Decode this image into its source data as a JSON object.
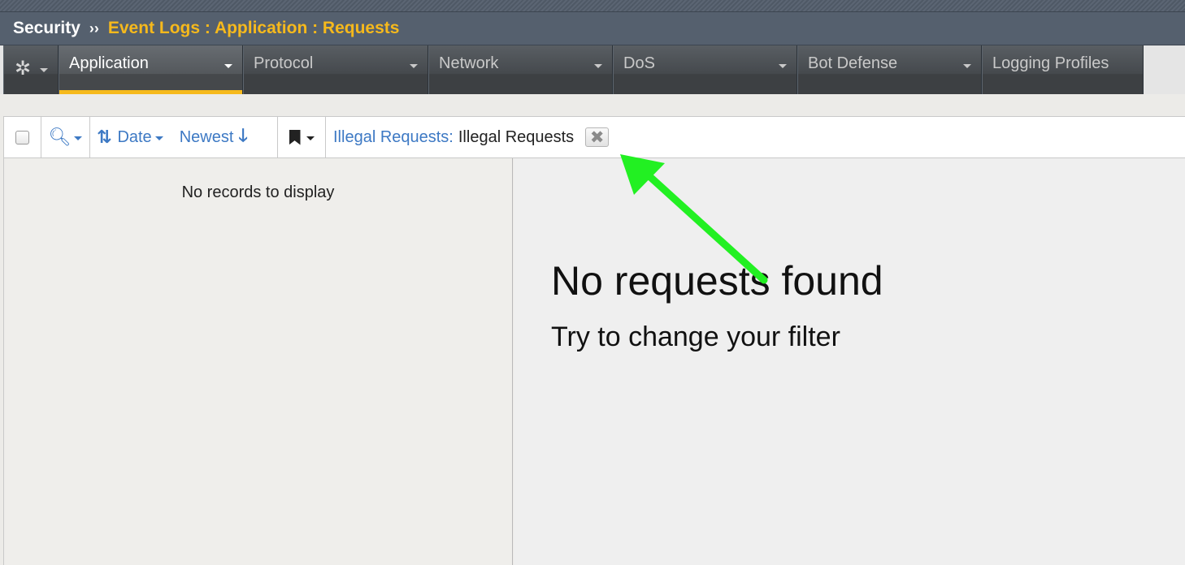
{
  "breadcrumb": {
    "root": "Security",
    "separator": "››",
    "current": "Event Logs : Application : Requests"
  },
  "tabs": [
    {
      "label": "Application",
      "active": true
    },
    {
      "label": "Protocol",
      "active": false
    },
    {
      "label": "Network",
      "active": false
    },
    {
      "label": "DoS",
      "active": false
    },
    {
      "label": "Bot Defense",
      "active": false
    },
    {
      "label": "Logging Profiles",
      "active": false
    }
  ],
  "toolbar": {
    "sort_field": "Date",
    "sort_order": "Newest",
    "filter_key": "Illegal Requests:",
    "filter_value": "Illegal Requests"
  },
  "list": {
    "empty_text": "No records to display"
  },
  "detail": {
    "empty_title": "No requests found",
    "empty_hint": "Try to change your filter"
  },
  "colors": {
    "accent": "#f6b91c",
    "link": "#3d79c4",
    "annotation_arrow": "#22f022"
  },
  "icons": [
    "gear-icon",
    "search-icon",
    "sort-icon",
    "arrow-down-icon",
    "bookmark-icon",
    "close-icon"
  ]
}
